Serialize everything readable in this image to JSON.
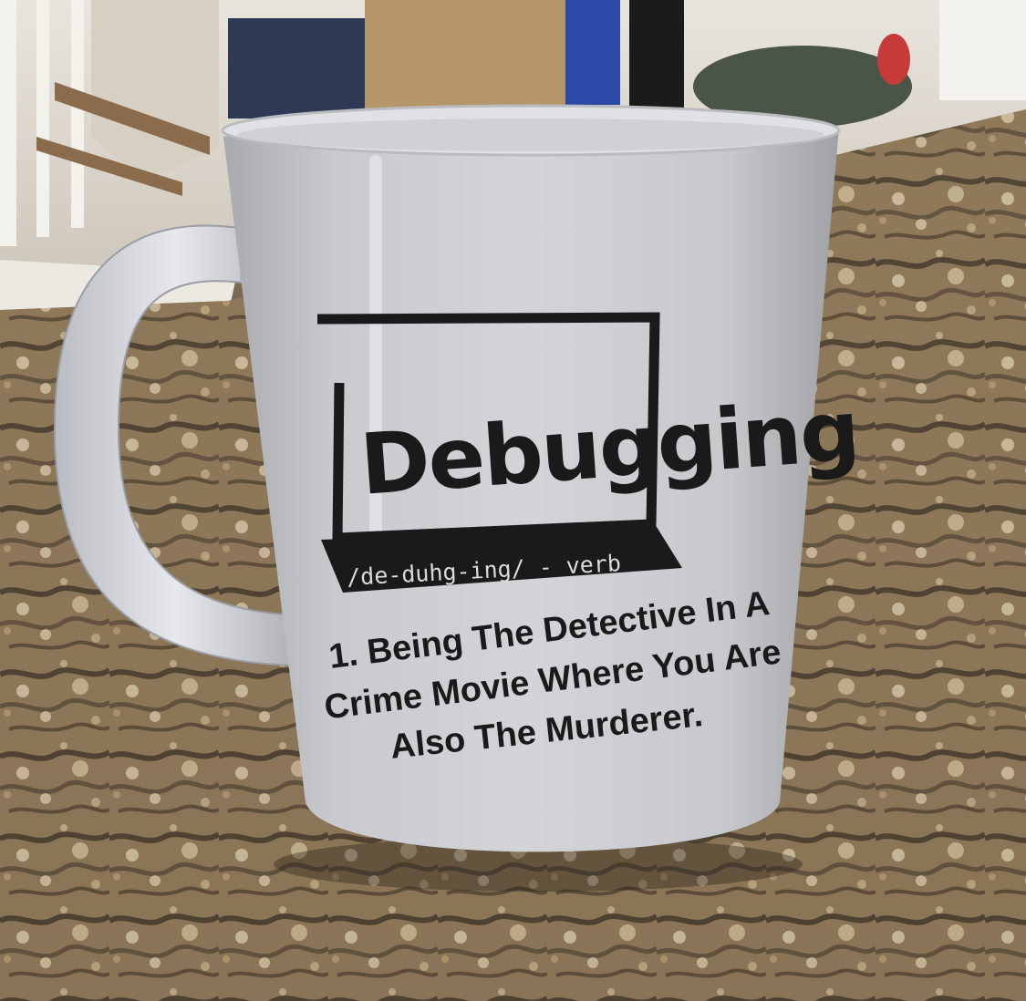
{
  "mug": {
    "title": "Debugging",
    "pronunciation": "/de-duhg-ing/ - verb",
    "definition_lines": [
      "1. Being The Detective In A",
      "Crime Movie Where You Are",
      "Also The Murderer."
    ]
  },
  "colors": {
    "mug_body": "#c9cbcf",
    "mug_ink": "#1a1a1a",
    "countertop_base": "#8a7458",
    "countertop_dark": "#2e261e",
    "countertop_light": "#d6c6a8",
    "wall": "#e8e4dc"
  }
}
